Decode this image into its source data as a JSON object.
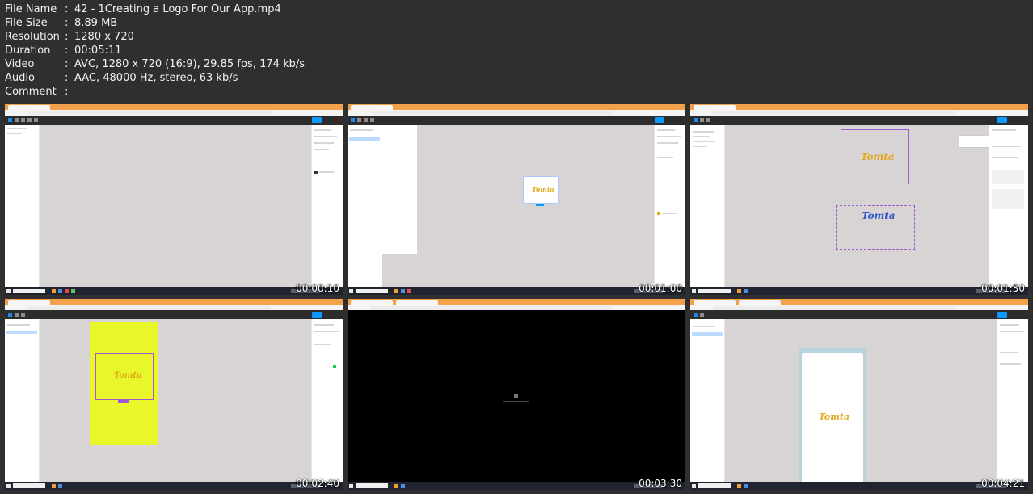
{
  "file_info": {
    "rows": [
      {
        "key": "File Name",
        "value": "42 - 1Creating a Logo For Our App.mp4"
      },
      {
        "key": "File Size",
        "value": "8.89 MB"
      },
      {
        "key": "Resolution",
        "value": "1280 x 720"
      },
      {
        "key": "Duration",
        "value": "00:05:11"
      },
      {
        "key": "Video",
        "value": "AVC, 1280 x 720 (16:9), 29.85 fps, 174 kb/s"
      },
      {
        "key": "Audio",
        "value": "AAC, 48000 Hz, stereo, 63 kb/s"
      },
      {
        "key": "Comment",
        "value": ""
      }
    ],
    "separator": ":"
  },
  "thumbnails": [
    {
      "timestamp": "00:00:10",
      "logo_text": ""
    },
    {
      "timestamp": "00:01:00",
      "logo_text": "Tomta"
    },
    {
      "timestamp": "00:01:50",
      "logo_text": "Tomta",
      "logo_text_2": "Tomta"
    },
    {
      "timestamp": "00:02:40",
      "logo_text": "Tomta"
    },
    {
      "timestamp": "00:03:30",
      "logo_text": ""
    },
    {
      "timestamp": "00:04:21",
      "logo_text": "Tomta"
    }
  ],
  "colors": {
    "logo_gold": "#e0a81c",
    "logo_blue": "#2f55c8",
    "yellow_frame": "#e9f72a",
    "selection_purple": "#a15ad6",
    "browser_tab_orange": "#f2a04a",
    "figma_blue": "#0d99ff"
  }
}
